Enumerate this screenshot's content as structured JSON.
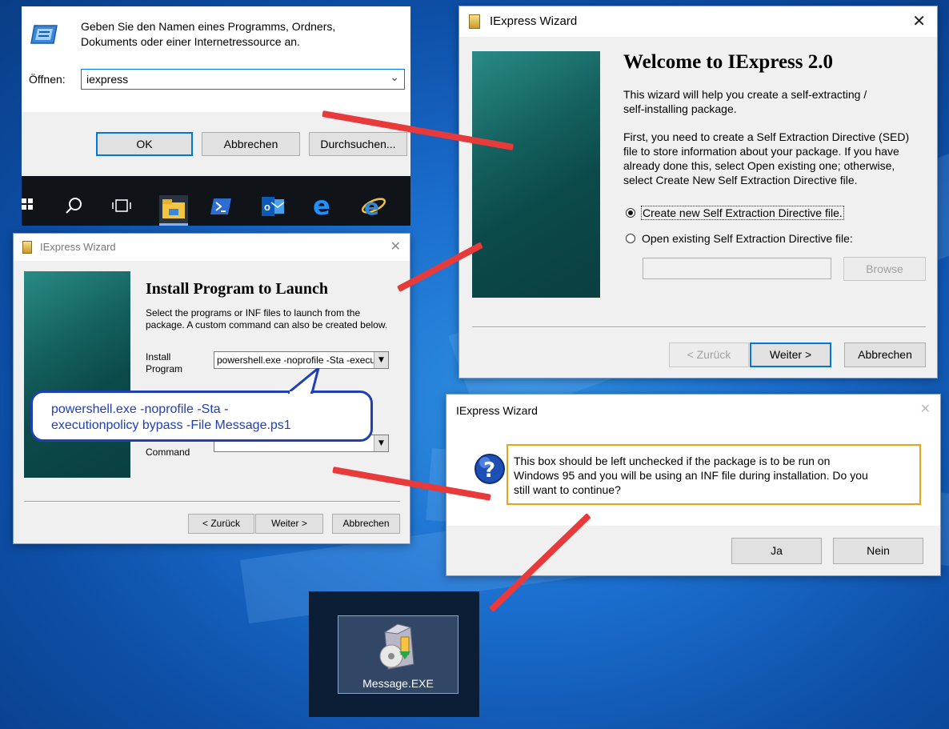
{
  "run_dialog": {
    "description": "Geben Sie den Namen eines Programms, Ordners, Dokuments oder einer Internetressource an.",
    "open_label": "Öffnen:",
    "input_value": "iexpress",
    "ok": "OK",
    "cancel": "Abbrechen",
    "browse": "Durchsuchen..."
  },
  "taskbar": {
    "icons": [
      "windows-start-icon",
      "search-icon",
      "task-view-icon",
      "file-explorer-icon",
      "powershell-icon",
      "outlook-icon",
      "edge-icon",
      "internet-explorer-icon"
    ]
  },
  "welcome_wizard": {
    "title": "IExpress Wizard",
    "heading": "Welcome to IExpress 2.0",
    "intro_line1": "This wizard will help you create a self-extracting /",
    "intro_line2": "self-installing package.",
    "body_line1": "First, you need to create a Self Extraction Directive (SED)",
    "body_line2": "file to store information about your package.  If you have",
    "body_line3": "already done this, select Open existing one; otherwise,",
    "body_line4": "select Create New Self Extraction Directive file.",
    "option_create": "Create new Self Extraction Directive file.",
    "option_open": "Open existing Self Extraction Directive file:",
    "file_value": "",
    "browse": "Browse",
    "back": "< Zurück",
    "next": "Weiter >",
    "cancel": "Abbrechen"
  },
  "install_wizard": {
    "title": "IExpress Wizard",
    "heading": "Install Program to Launch",
    "desc_line1": "Select the programs or INF files to launch from the",
    "desc_line2": "package.  A custom command can also be created below.",
    "install_label_1": "Install",
    "install_label_2": "Program",
    "program_value": "powershell.exe -noprofile -Sta -execu",
    "command_label": "Command",
    "back": "< Zurück",
    "next": "Weiter >",
    "cancel": "Abbrechen"
  },
  "callout": {
    "line1": "powershell.exe -noprofile -Sta -",
    "line2": "executionpolicy bypass -File Message.ps1"
  },
  "confirm_dialog": {
    "title": "IExpress Wizard",
    "line1": "This box should be left unchecked if the package is to be run on",
    "line2": "Windows 95 and you will be using an INF file during installation. Do you",
    "line3": "still want to continue?",
    "yes": "Ja",
    "no": "Nein"
  },
  "desktop_file": {
    "label": "Message.EXE"
  },
  "colors": {
    "arrow": "#e83a3a",
    "callout_border": "#1f3fb4",
    "callout_text": "#1f3fb4",
    "highlight_border": "#e8a317",
    "accent": "#0078d7"
  }
}
